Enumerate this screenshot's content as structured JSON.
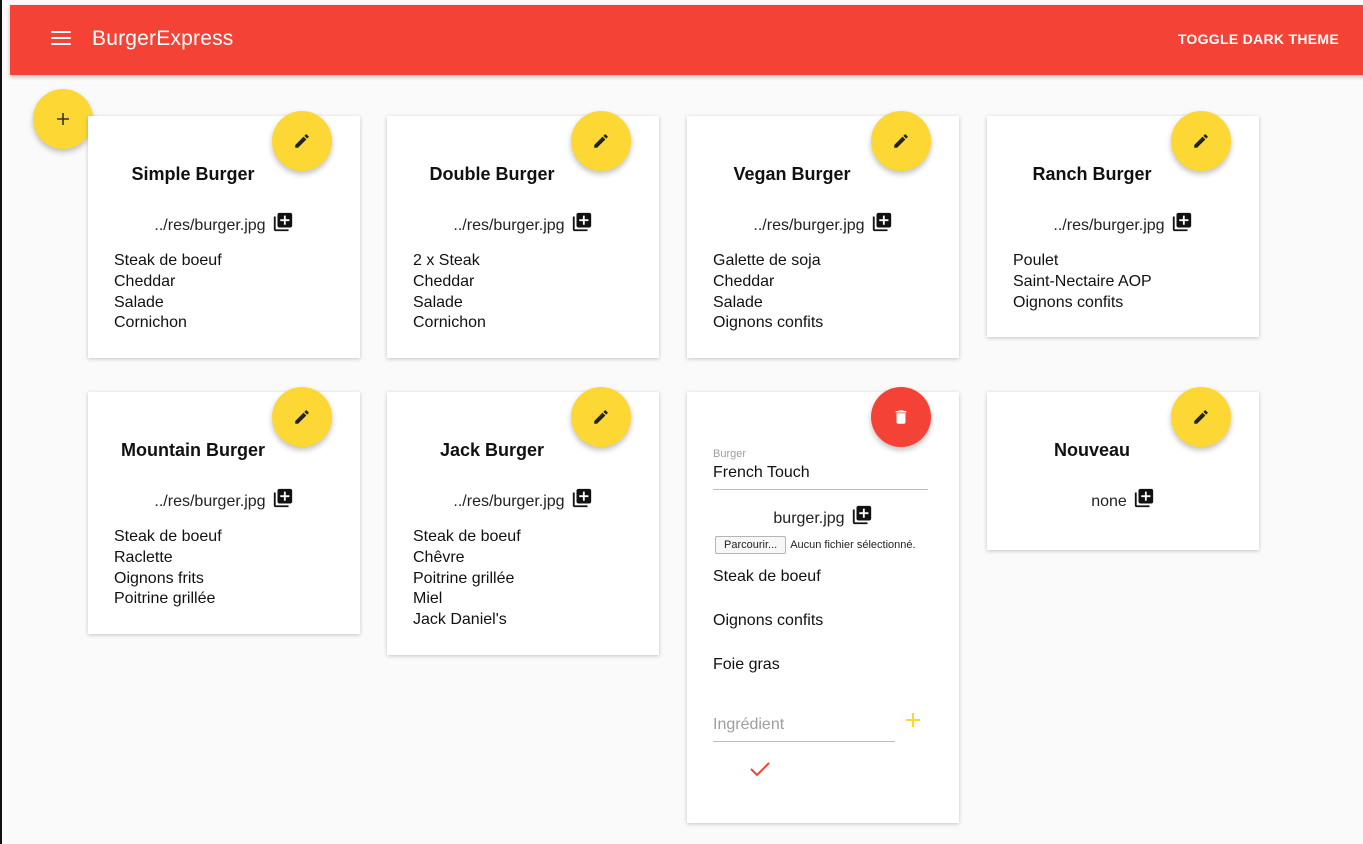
{
  "appbar": {
    "title": "BurgerExpress",
    "toggle_label": "TOGGLE DARK THEME"
  },
  "colors": {
    "primary": "#f44336",
    "accent": "#fdd835",
    "background": "#fafafa"
  },
  "burgers": [
    {
      "name": "Simple Burger",
      "image": "../res/burger.jpg",
      "ingredients": [
        "Steak de boeuf",
        "Cheddar",
        "Salade",
        "Cornichon"
      ]
    },
    {
      "name": "Double Burger",
      "image": "../res/burger.jpg",
      "ingredients": [
        "2 x Steak",
        "Cheddar",
        "Salade",
        "Cornichon"
      ]
    },
    {
      "name": "Vegan Burger",
      "image": "../res/burger.jpg",
      "ingredients": [
        "Galette de soja",
        "Cheddar",
        "Salade",
        "Oignons confits"
      ]
    },
    {
      "name": "Ranch Burger",
      "image": "../res/burger.jpg",
      "ingredients": [
        "Poulet",
        "Saint-Nectaire AOP",
        "Oignons confits"
      ]
    },
    {
      "name": "Mountain Burger",
      "image": "../res/burger.jpg",
      "ingredients": [
        "Steak de boeuf",
        "Raclette",
        "Oignons frits",
        "Poitrine grillée"
      ]
    },
    {
      "name": "Jack Burger",
      "image": "../res/burger.jpg",
      "ingredients": [
        "Steak de boeuf",
        "Chêvre",
        "Poitrine grillée",
        "Miel",
        "Jack Daniel's"
      ]
    }
  ],
  "edit_card": {
    "field_label": "Burger",
    "name_value": "French Touch",
    "image": "burger.jpg",
    "browse_label": "Parcourir...",
    "no_file_label": "Aucun fichier sélectionné.",
    "ingredients": [
      "Steak de boeuf",
      "Oignons confits",
      "Foie gras"
    ],
    "ingredient_placeholder": "Ingrédient"
  },
  "new_card": {
    "name": "Nouveau",
    "image": "none"
  }
}
